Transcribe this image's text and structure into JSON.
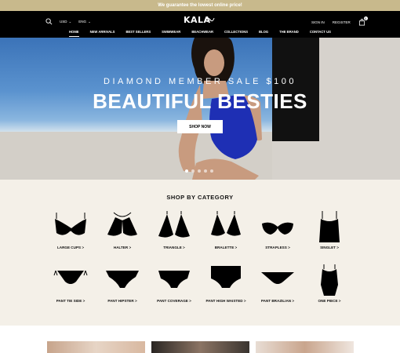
{
  "promo": {
    "text": "We guarantee the lowest online price!"
  },
  "header": {
    "currency": "USD",
    "language": "ENG",
    "logo": "KALA",
    "signin": "SIGN IN",
    "register": "REGISTER",
    "cart_count": "0"
  },
  "nav": [
    "HOME",
    "NEW ARRIVALS",
    "BEST SELLERS",
    "SWIMWEAR",
    "BEACHWEAR",
    "COLLECTIONS",
    "BLOG",
    "THE BRAND",
    "CONTACT US"
  ],
  "hero": {
    "subtitle": "DIAMOND MEMBER SALE $100",
    "title": "BEAUTIFUL BESTIES",
    "cta": "SHOP NOW"
  },
  "categories": {
    "title": "SHOP BY CATEGORY",
    "row1": [
      "LARGE CUPS >",
      "HALTER >",
      "TRIANGLE >",
      "BRALETTE >",
      "STRAPLESS >",
      "SINGLET >"
    ],
    "row2": [
      "PANT TIE SIDE >",
      "PANT HIPSTER >",
      "PANT COVERAGE >",
      "PANT HIGH WAISTED >",
      "PANT BRAZILIAN >",
      "ONE PIECE >"
    ]
  },
  "colors": {
    "promo": "#c8b98c",
    "header": "#000000",
    "category_bg": "#f4f0e8"
  }
}
